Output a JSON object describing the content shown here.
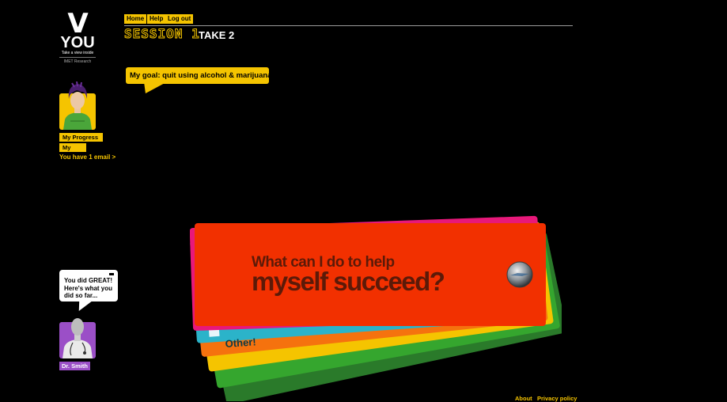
{
  "logo": {
    "mark": "V",
    "word": "YOU",
    "tagline": "Take a view inside",
    "research": "IMET Research"
  },
  "nav": {
    "home_label": "Home",
    "help_label": "Help",
    "logout_label": "Log out"
  },
  "session": {
    "label": "SESSION 1",
    "take": "TAKE 2"
  },
  "goal": {
    "text": "My goal: quit using alcohol & marijuana"
  },
  "sidebar": {
    "my_progress": "My Progress",
    "my_page": "My Page",
    "email_notice": "You have 1 email >"
  },
  "doctor": {
    "bubble_lines": [
      "You did GREAT!",
      "Here's what you",
      "did so far..."
    ],
    "name": "Dr. Smith"
  },
  "cards": {
    "question_line1": "What can I do to help",
    "question_line2": "myself succeed?",
    "back_card_label": "Other!",
    "colors": [
      "#f23000",
      "#e8187a",
      "#2bb3c9",
      "#f5720e",
      "#f5c400",
      "#35a62e",
      "#2a7a2a"
    ]
  },
  "footer": {
    "about": "About",
    "privacy": "Privacy policy"
  },
  "colors": {
    "background": "#000000",
    "accent": "#f5c400",
    "doctor_badge": "#9b4fc7"
  }
}
